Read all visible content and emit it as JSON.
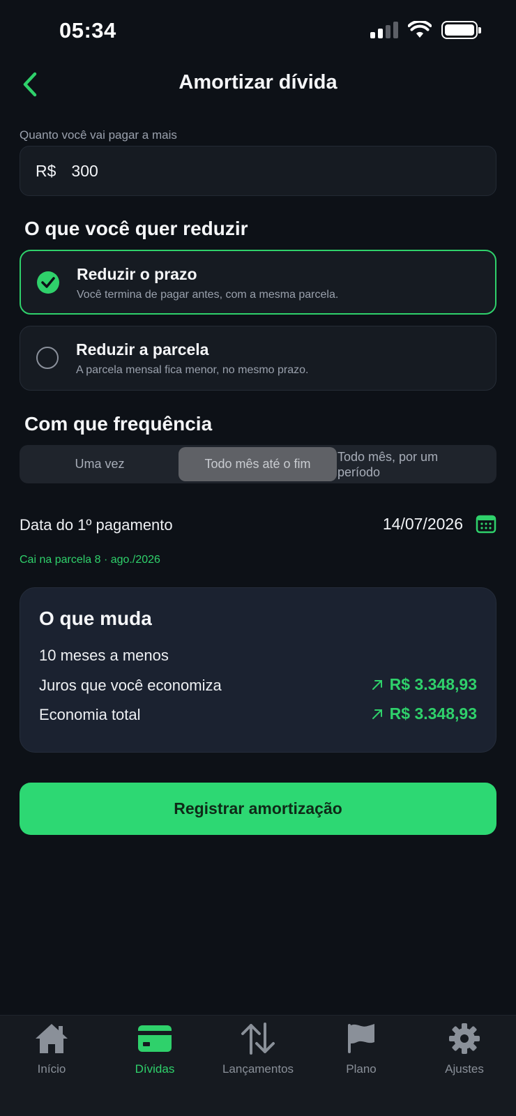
{
  "status_bar": {
    "time": "05:34"
  },
  "header": {
    "title": "Amortizar dívida"
  },
  "amount": {
    "label": "Quanto você vai pagar a mais",
    "currency": "R$",
    "value": "300"
  },
  "reduce_section": {
    "title": "O que você quer reduzir",
    "options": [
      {
        "title": "Reduzir o prazo",
        "description": "Você termina de pagar antes, com a mesma parcela.",
        "selected": true
      },
      {
        "title": "Reduzir a parcela",
        "description": "A parcela mensal fica menor, no mesmo prazo.",
        "selected": false
      }
    ]
  },
  "frequency_section": {
    "title": "Com que frequência",
    "segments": [
      "Uma vez",
      "Todo mês até o fim",
      "Todo mês, por um período"
    ],
    "selected_index": 1
  },
  "first_payment": {
    "label": "Data do 1º pagamento",
    "date": "14/07/2026",
    "hint": "Cai na parcela 8 · ago./2026"
  },
  "summary": {
    "title": "O que muda",
    "months_text": "10 meses a menos",
    "interest_label": "Juros que você economiza",
    "interest_value": "R$ 3.348,93",
    "total_label": "Economia total",
    "total_value": "R$ 3.348,93"
  },
  "primary_button": {
    "label": "Registrar amortização"
  },
  "tabbar": {
    "items": [
      {
        "label": "Início",
        "icon": "home-icon"
      },
      {
        "label": "Dívidas",
        "icon": "card-icon",
        "active": true
      },
      {
        "label": "Lançamentos",
        "icon": "arrows-up-down-icon"
      },
      {
        "label": "Plano",
        "icon": "flag-icon"
      },
      {
        "label": "Ajustes",
        "icon": "gear-icon"
      }
    ]
  },
  "colors": {
    "accent": "#2fd16b",
    "background": "#0d1117",
    "card": "#161b22",
    "summary_card": "#1b2230"
  }
}
